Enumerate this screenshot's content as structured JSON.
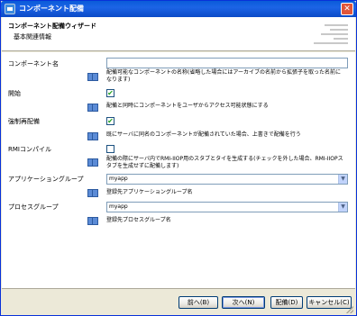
{
  "window": {
    "title": "コンポーネント配備",
    "close_glyph": "✕"
  },
  "header": {
    "title": "コンポーネント配備ウィザード",
    "subtitle": "基本関連情報"
  },
  "fields": {
    "component_name": {
      "label": "コンポーネント名",
      "value": "",
      "desc": "配備可能なコンポーネントの名称(省略した場合にはアーカイブの名前から拡張子を取った名前になります)"
    },
    "start": {
      "label": "開始",
      "checked": "✔",
      "desc": "配備と同時にコンポーネントをユーザからアクセス可能状態にする"
    },
    "force_redeploy": {
      "label": "強制再配備",
      "checked": "✔",
      "desc": "既にサーバに同名のコンポーネントが配備されていた場合、上書きで配備を行う"
    },
    "rmi_compile": {
      "label": "RMIコンパイル",
      "checked": "",
      "desc": "配備の際にサーバ内でRMI-IIOP用のスタブとタイを生成する(チェックを外した場合、RMI-IIOPスタブを生成せずに配備します)"
    },
    "app_group": {
      "label": "アプリケーショングループ",
      "value": "myapp",
      "arrow": "▼",
      "desc": "登録先アプリケーショングループ名"
    },
    "process_group": {
      "label": "プロセスグループ",
      "value": "myapp",
      "arrow": "▼",
      "desc": "登録先プロセスグループ名"
    }
  },
  "buttons": {
    "back": "前へ(B)",
    "next": "次へ(N)",
    "deploy": "配備(D)",
    "cancel": "キャンセル(C)"
  }
}
